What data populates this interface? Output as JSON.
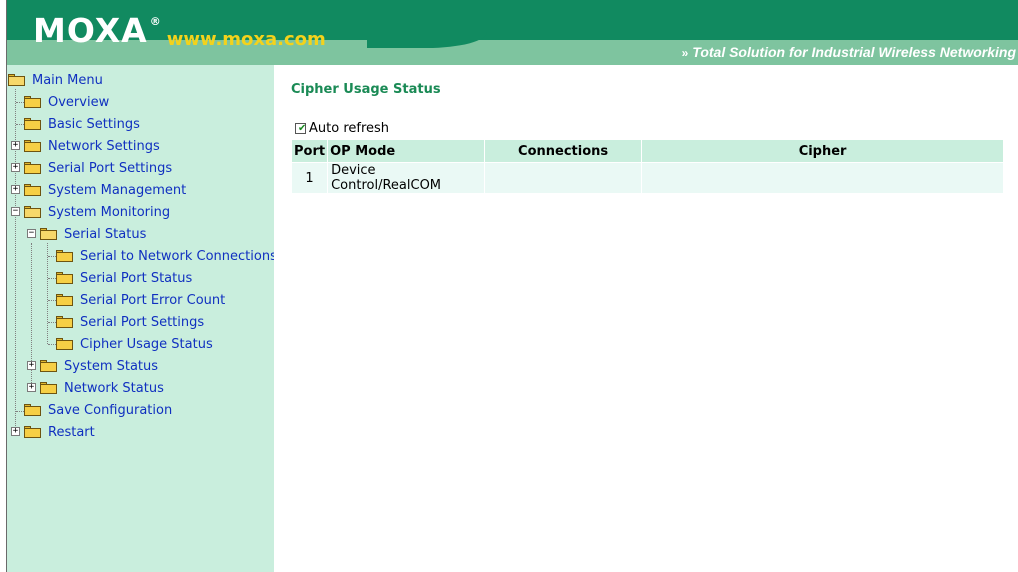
{
  "header": {
    "brand": "MOXA",
    "registered": "®",
    "url": "www.moxa.com",
    "tagline_prefix": "»",
    "tagline": "Total Solution for Industrial Wireless Networking"
  },
  "menu": {
    "root": "Main Menu",
    "overview": "Overview",
    "basic_settings": "Basic Settings",
    "network_settings": "Network Settings",
    "serial_port_settings": "Serial Port Settings",
    "system_management": "System Management",
    "system_monitoring": "System Monitoring",
    "serial_status": "Serial Status",
    "serial_to_network": "Serial to Network Connections",
    "serial_port_status": "Serial Port Status",
    "serial_port_error_count": "Serial Port Error Count",
    "serial_port_settings_sub": "Serial Port Settings",
    "cipher_usage_status": "Cipher Usage Status",
    "system_status": "System Status",
    "network_status": "Network Status",
    "save_configuration": "Save Configuration",
    "restart": "Restart",
    "expand_symbol": "+",
    "collapse_symbol": "−"
  },
  "main": {
    "title": "Cipher Usage Status",
    "auto_refresh_label": "Auto refresh",
    "auto_refresh_checked": true,
    "check_mark": "✔",
    "table": {
      "headers": [
        "Port",
        "OP Mode",
        "Connections",
        "Cipher"
      ],
      "rows": [
        [
          "1",
          "Device Control/RealCOM",
          "",
          ""
        ]
      ]
    }
  },
  "colors": {
    "header_green": "#118a60",
    "header_band": "#7ec49f",
    "sidebar_bg": "#c9eedd",
    "link_blue": "#1030c0",
    "title_green": "#1a8a55",
    "url_yellow": "#f3d21c"
  }
}
